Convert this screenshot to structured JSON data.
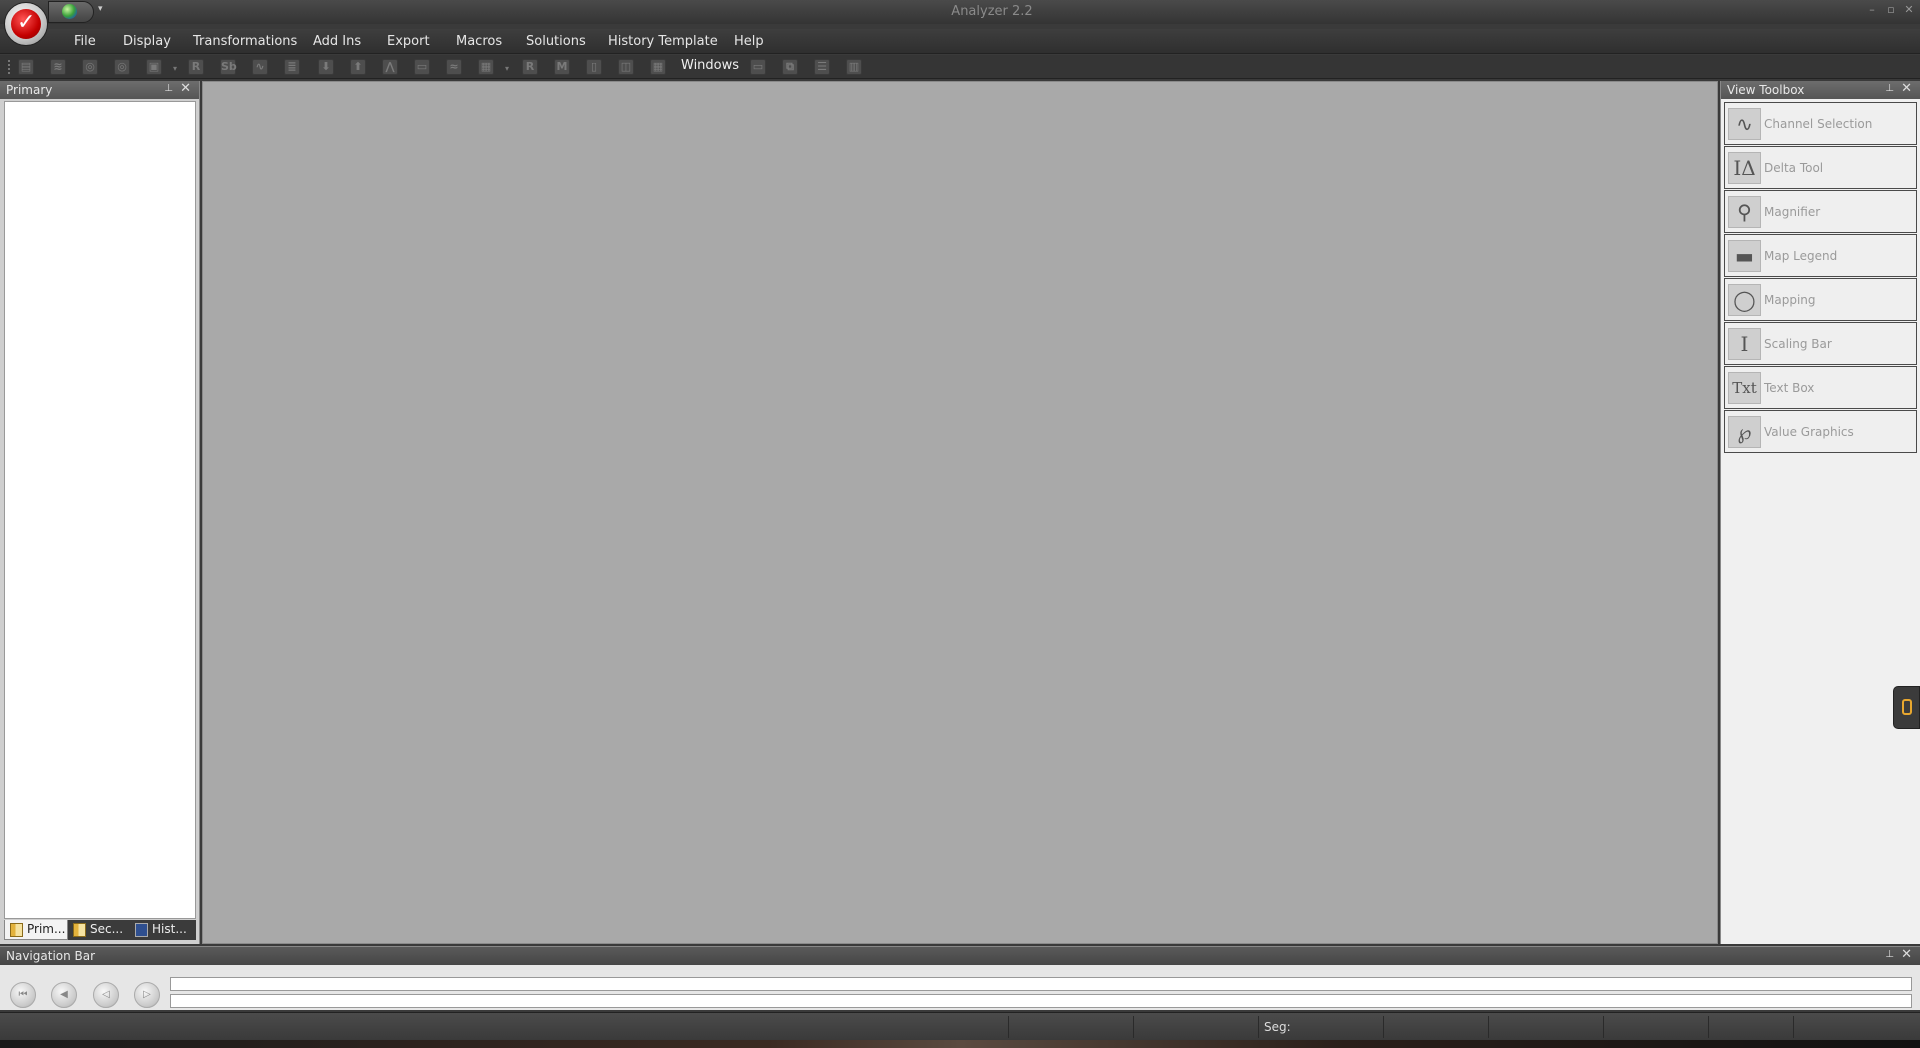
{
  "window": {
    "title": "Analyzer 2.2",
    "controls": [
      "minimize-icon",
      "restore-icon",
      "close-icon"
    ]
  },
  "quick_access": {
    "icons": [
      "app-orb-icon",
      "globe-icon",
      "chevron-down-icon"
    ]
  },
  "menu": {
    "items": [
      "File",
      "Display",
      "Transformations",
      "Add Ins",
      "Export",
      "Macros",
      "Solutions",
      "History Template",
      "Help"
    ]
  },
  "toolbar": {
    "windows_label": "Windows",
    "buttons": [
      {
        "icon": "open-node-icon",
        "glyph": "▤"
      },
      {
        "icon": "transform-icon",
        "glyph": "≋"
      },
      {
        "icon": "zoom-in-icon",
        "glyph": "◎"
      },
      {
        "icon": "zoom-out-icon",
        "glyph": "◎"
      },
      {
        "icon": "zoom-fit-icon",
        "glyph": "▣"
      },
      {
        "icon": "r-icon",
        "glyph": "R"
      },
      {
        "icon": "sb-icon",
        "glyph": "Sb"
      },
      {
        "icon": "waveform-icon",
        "glyph": "∿"
      },
      {
        "icon": "list-icon",
        "glyph": "≣"
      },
      {
        "icon": "arrow-down-icon",
        "glyph": "⬇"
      },
      {
        "icon": "arrow-up-icon",
        "glyph": "⬆"
      },
      {
        "icon": "peak-icon",
        "glyph": "⋀"
      },
      {
        "icon": "baseline-icon",
        "glyph": "▭"
      },
      {
        "icon": "overlay-icon",
        "glyph": "≈"
      },
      {
        "icon": "grid-icon",
        "glyph": "▦"
      },
      {
        "icon": "r-marker-icon",
        "glyph": "R"
      },
      {
        "icon": "m-marker-icon",
        "glyph": "M"
      },
      {
        "icon": "book-icon",
        "glyph": "▯"
      },
      {
        "icon": "layout-icon",
        "glyph": "◫"
      },
      {
        "icon": "tile-icon",
        "glyph": "▦"
      },
      {
        "icon": "window-single-icon",
        "glyph": "▭"
      },
      {
        "icon": "window-cascade-icon",
        "glyph": "⧉"
      },
      {
        "icon": "window-horizontal-icon",
        "glyph": "☰"
      },
      {
        "icon": "window-vertical-icon",
        "glyph": "▥"
      }
    ]
  },
  "primary_panel": {
    "title": "Primary",
    "tabs": [
      {
        "label": "Prim...",
        "icon": "book-icon",
        "active": true
      },
      {
        "label": "Sec...",
        "icon": "book-icon",
        "active": false
      },
      {
        "label": "Hist...",
        "icon": "history-icon",
        "active": false
      }
    ]
  },
  "view_toolbox": {
    "title": "View Toolbox",
    "tools": [
      {
        "label": "Channel Selection",
        "icon": "channel-selection-icon",
        "glyph": "∿"
      },
      {
        "label": "Delta Tool",
        "icon": "delta-tool-icon",
        "glyph": "IΔ"
      },
      {
        "label": "Magnifier",
        "icon": "magnifier-icon",
        "glyph": "⚲"
      },
      {
        "label": "Map Legend",
        "icon": "map-legend-icon",
        "glyph": "▬"
      },
      {
        "label": "Mapping",
        "icon": "mapping-icon",
        "glyph": "◯"
      },
      {
        "label": "Scaling Bar",
        "icon": "scaling-bar-icon",
        "glyph": "I"
      },
      {
        "label": "Text Box",
        "icon": "text-box-icon",
        "glyph": "Txt"
      },
      {
        "label": "Value Graphics",
        "icon": "value-graphics-icon",
        "glyph": "℘"
      }
    ]
  },
  "navigation_bar": {
    "title": "Navigation Bar",
    "buttons": [
      "first-icon",
      "previous-icon",
      "back-icon",
      "forward-icon"
    ]
  },
  "status_bar": {
    "seg_label": "Seg:"
  },
  "colors": {
    "chrome_dark": "#353535",
    "workspace": "#a9a9a9",
    "panel_light": "#f0f0f0",
    "accent_orange": "#e8a72f",
    "orb_red": "#c40000"
  }
}
